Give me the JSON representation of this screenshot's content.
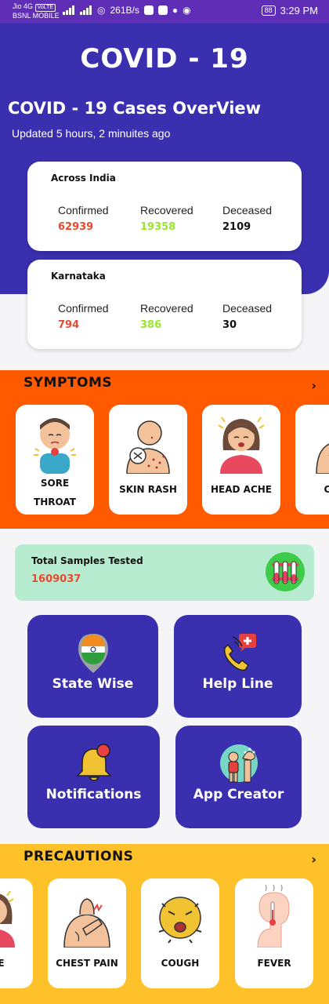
{
  "status_bar": {
    "carrier_line1": "Jio 4G",
    "volte": "VoLTE",
    "carrier_line2": "BSNL MOBILE",
    "network_speed": "261B/s",
    "battery": "88",
    "time": "3:29 PM"
  },
  "header": {
    "app_title": "COVID - 19",
    "overview_title": "COVID - 19 Cases OverView",
    "updated": "Updated 5 hours, 2 minuites ago"
  },
  "cards": [
    {
      "region": "Across India",
      "confirmed_label": "Confirmed",
      "confirmed": "62939",
      "recovered_label": "Recovered",
      "recovered": "19358",
      "deceased_label": "Deceased",
      "deceased": "2109"
    },
    {
      "region": "Karnataka",
      "confirmed_label": "Confirmed",
      "confirmed": "794",
      "recovered_label": "Recovered",
      "recovered": "386",
      "deceased_label": "Deceased",
      "deceased": "30"
    }
  ],
  "symptoms": {
    "title": "SYMPTOMS",
    "arrow": "›",
    "items": [
      {
        "line1": "SORE",
        "line2": "THROAT",
        "icon": "sore-throat-icon"
      },
      {
        "label": "SKIN RASH",
        "icon": "skin-rash-icon"
      },
      {
        "label": "HEAD ACHE",
        "icon": "head-ache-icon"
      },
      {
        "label": "CHE",
        "icon": "chest-icon"
      }
    ]
  },
  "samples": {
    "label": "Total Samples Tested",
    "value": "1609037",
    "icon": "test-tubes-icon"
  },
  "grid": {
    "state_wise": "State Wise",
    "help_line": "Help Line",
    "notifications": "Notifications",
    "app_creator": "App Creator"
  },
  "precautions": {
    "title": "PRECAUTIONS",
    "arrow": "›",
    "items": [
      {
        "label": "CHE",
        "icon": "head-ache-icon"
      },
      {
        "label": "CHEST PAIN",
        "icon": "chest-pain-icon"
      },
      {
        "label": "COUGH",
        "icon": "cough-icon"
      },
      {
        "label": "FEVER",
        "icon": "fever-icon"
      }
    ]
  },
  "colors": {
    "primary": "#3a2fae",
    "status_bar": "#5e2fb6",
    "symptoms_bg": "#ff5a00",
    "precautions_bg": "#ffc12a",
    "confirmed": "#e8492f",
    "recovered": "#98e62f",
    "samples_bg": "#b8ecd0"
  }
}
